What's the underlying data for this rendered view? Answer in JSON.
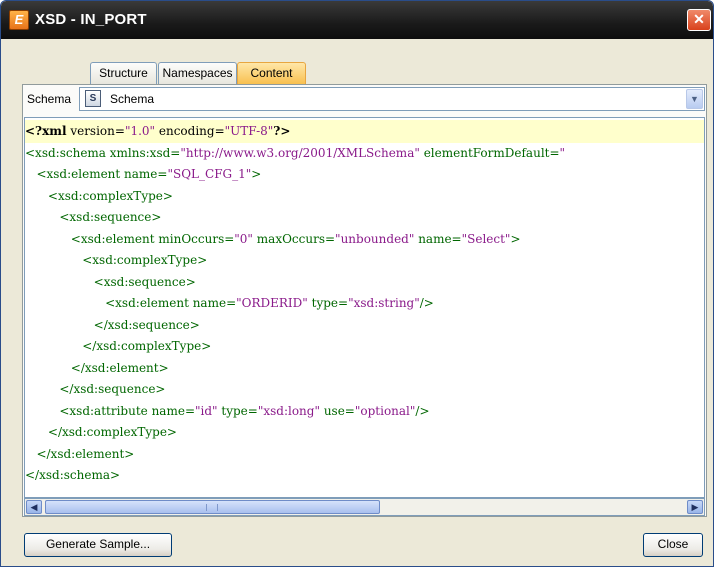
{
  "window": {
    "title": "XSD - IN_PORT",
    "app_icon": "app-logo-icon",
    "close_icon": "close-icon"
  },
  "tabs": [
    {
      "label": "Structure",
      "active": false
    },
    {
      "label": "Namespaces",
      "active": false
    },
    {
      "label": "Content",
      "active": true
    }
  ],
  "schema_selector": {
    "label": "Schema",
    "selected": "Schema",
    "icon": "schema-icon",
    "dropdown_icon": "chevron-down-icon"
  },
  "editor": {
    "lines": [
      {
        "indent": "",
        "text": "<?xml version=\"1.0\" encoding=\"UTF-8\"?>"
      },
      {
        "indent": "",
        "text": "<xsd:schema xmlns:xsd=\"http://www.w3.org/2001/XMLSchema\" elementFormDefault=\""
      },
      {
        "indent": "   ",
        "text": "<xsd:element name=\"SQL_CFG_1\">"
      },
      {
        "indent": "      ",
        "text": "<xsd:complexType>"
      },
      {
        "indent": "         ",
        "text": "<xsd:sequence>"
      },
      {
        "indent": "            ",
        "text": "<xsd:element minOccurs=\"0\" maxOccurs=\"unbounded\" name=\"Select\">"
      },
      {
        "indent": "               ",
        "text": "<xsd:complexType>"
      },
      {
        "indent": "                  ",
        "text": "<xsd:sequence>"
      },
      {
        "indent": "                     ",
        "text": "<xsd:element name=\"ORDERID\" type=\"xsd:string\"/>"
      },
      {
        "indent": "                  ",
        "text": "</xsd:sequence>"
      },
      {
        "indent": "               ",
        "text": "</xsd:complexType>"
      },
      {
        "indent": "            ",
        "text": "</xsd:element>"
      },
      {
        "indent": "         ",
        "text": "</xsd:sequence>"
      },
      {
        "indent": "         ",
        "text": "<xsd:attribute name=\"id\" type=\"xsd:long\" use=\"optional\"/>"
      },
      {
        "indent": "      ",
        "text": "</xsd:complexType>"
      },
      {
        "indent": "   ",
        "text": "</xsd:element>"
      },
      {
        "indent": "",
        "text": "</xsd:schema>"
      }
    ]
  },
  "scrollbar": {
    "left_icon": "scroll-left-icon",
    "right_icon": "scroll-right-icon"
  },
  "buttons": {
    "generate_sample": "Generate Sample...",
    "close": "Close"
  }
}
